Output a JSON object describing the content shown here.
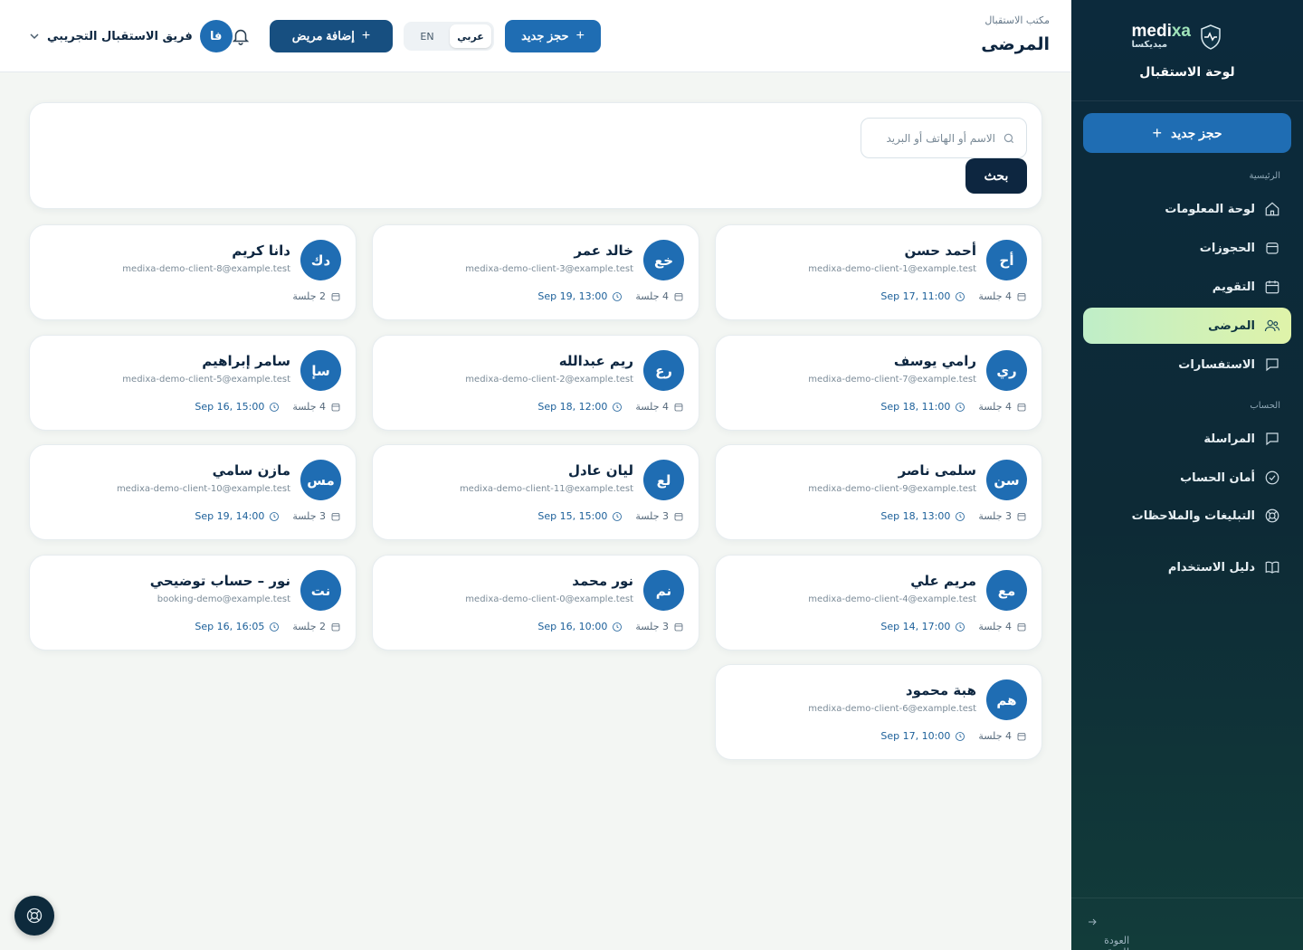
{
  "brand": {
    "name_en_a": "medi",
    "name_en_b": "xa",
    "name_ar": "ميديكسا",
    "subtitle": "لوحة الاستقبال"
  },
  "sidebar": {
    "cta": "حجز جديد",
    "section_main": "الرئيسية",
    "section_account": "الحساب",
    "items": [
      {
        "label": "لوحة المعلومات",
        "icon": "home-icon"
      },
      {
        "label": "الحجوزات",
        "icon": "calendar-icon"
      },
      {
        "label": "التقويم",
        "icon": "calendar-icon"
      },
      {
        "label": "المرضى",
        "icon": "users-icon",
        "active": true
      },
      {
        "label": "الاستفسارات",
        "icon": "chat-icon"
      },
      {
        "label": "المراسلة",
        "icon": "chat-icon"
      },
      {
        "label": "أمان الحساب",
        "icon": "check-circle-icon"
      },
      {
        "label": "التبليغات والملاحظات",
        "icon": "lifebuoy-icon"
      },
      {
        "label": "دليل الاستخدام",
        "icon": "book-icon"
      }
    ],
    "back": "العودة للموقع"
  },
  "header": {
    "crumb": "مكتب الاستقبال",
    "title": "المرضى",
    "new_booking": "حجز جديد",
    "lang_ar": "عربي",
    "lang_en": "EN",
    "add_patient": "إضافة مريض",
    "user_initials": "فا",
    "user_name": "فريق الاستقبال التجريبي"
  },
  "search": {
    "placeholder": "الاسم أو الهاتف أو البريد",
    "button": "بحث"
  },
  "patients": [
    {
      "initials": "أح",
      "name": "أحمد حسن",
      "email": "medixa-demo-client-1@example.test",
      "sessions": "4 جلسة",
      "last": "Sep 17, 11:00"
    },
    {
      "initials": "خع",
      "name": "خالد عمر",
      "email": "medixa-demo-client-3@example.test",
      "sessions": "4 جلسة",
      "last": "Sep 19, 13:00"
    },
    {
      "initials": "دك",
      "name": "دانا كريم",
      "email": "medixa-demo-client-8@example.test",
      "sessions": "2 جلسة",
      "last": ""
    },
    {
      "initials": "ري",
      "name": "رامي يوسف",
      "email": "medixa-demo-client-7@example.test",
      "sessions": "4 جلسة",
      "last": "Sep 18, 11:00"
    },
    {
      "initials": "رع",
      "name": "ريم عبدالله",
      "email": "medixa-demo-client-2@example.test",
      "sessions": "4 جلسة",
      "last": "Sep 18, 12:00"
    },
    {
      "initials": "سإ",
      "name": "سامر إبراهيم",
      "email": "medixa-demo-client-5@example.test",
      "sessions": "4 جلسة",
      "last": "Sep 16, 15:00"
    },
    {
      "initials": "سن",
      "name": "سلمى ناصر",
      "email": "medixa-demo-client-9@example.test",
      "sessions": "3 جلسة",
      "last": "Sep 18, 13:00"
    },
    {
      "initials": "لع",
      "name": "ليان عادل",
      "email": "medixa-demo-client-11@example.test",
      "sessions": "3 جلسة",
      "last": "Sep 15, 15:00"
    },
    {
      "initials": "مس",
      "name": "مازن سامي",
      "email": "medixa-demo-client-10@example.test",
      "sessions": "3 جلسة",
      "last": "Sep 19, 14:00"
    },
    {
      "initials": "مع",
      "name": "مريم علي",
      "email": "medixa-demo-client-4@example.test",
      "sessions": "4 جلسة",
      "last": "Sep 14, 17:00"
    },
    {
      "initials": "نم",
      "name": "نور محمد",
      "email": "medixa-demo-client-0@example.test",
      "sessions": "3 جلسة",
      "last": "Sep 16, 10:00"
    },
    {
      "initials": "نت",
      "name": "نور – حساب توضيحي",
      "email": "booking-demo@example.test",
      "sessions": "2 جلسة",
      "last": "Sep 16, 16:05"
    },
    {
      "initials": "هم",
      "name": "هبة محمود",
      "email": "medixa-demo-client-6@example.test",
      "sessions": "4 جلسة",
      "last": "Sep 17, 10:00"
    }
  ]
}
